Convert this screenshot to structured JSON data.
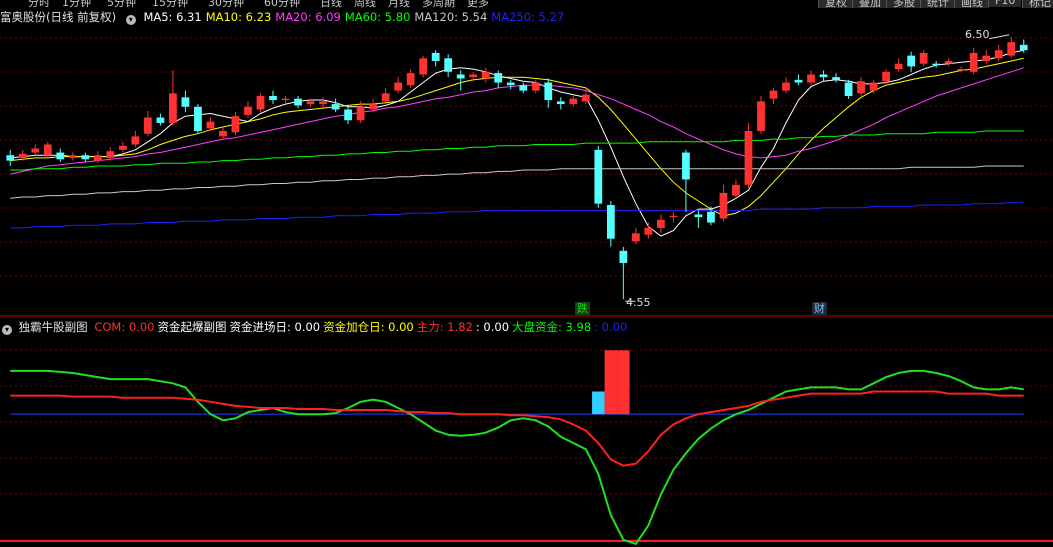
{
  "topbar": {
    "tabs": [
      "分时",
      "1分钟",
      "5分钟",
      "15分钟",
      "30分钟",
      "60分钟",
      "日线",
      "周线",
      "月线",
      "多周期",
      "更多"
    ],
    "buttons": [
      "复权",
      "叠加",
      "多股",
      "统计",
      "画线",
      "F10",
      "标记"
    ]
  },
  "main_panel": {
    "stock_name": "富奥股份(日线 前复权)",
    "ma": [
      {
        "label": "MA5: 6.31",
        "color": "#ffffff"
      },
      {
        "label": "MA10: 6.23",
        "color": "#ffff00"
      },
      {
        "label": "MA20: 6.09",
        "color": "#ff40ff"
      },
      {
        "label": "MA60: 5.80",
        "color": "#00ff00"
      },
      {
        "label": "MA120: 5.54",
        "color": "#c8c8c8"
      },
      {
        "label": "MA250: 5.27",
        "color": "#2020ff"
      }
    ],
    "high_label": "6.50",
    "low_label": "4.55",
    "event_tags": [
      "跌",
      "财"
    ]
  },
  "sub_panel": {
    "title": "独霸牛股副图",
    "indicators": [
      {
        "label": "COM: 0.00",
        "color": "#ff3030"
      },
      {
        "label": "资金起爆副图",
        "color": "#ffffff"
      },
      {
        "label": "资金进场日: 0.00",
        "color": "#ffffff"
      },
      {
        "label": "资金加仓日: 0.00",
        "color": "#ffff00"
      },
      {
        "label": "主力: 1.82",
        "color": "#ff3030"
      },
      {
        "label": ": 0.00",
        "color": "#ffffff"
      },
      {
        "label": "大盘资金: 3.98",
        "color": "#00ff00"
      },
      {
        "label": ": 0.00",
        "color": "#2020ff"
      }
    ]
  },
  "colors": {
    "up": "#ff3232",
    "down": "#54ffff",
    "grid": "#7a0000"
  },
  "chart_data": {
    "type": "candlestick",
    "ohlc": [
      [
        5.62,
        5.58,
        5.66,
        5.54
      ],
      [
        5.6,
        5.63,
        5.66,
        5.58
      ],
      [
        5.64,
        5.67,
        5.7,
        5.62
      ],
      [
        5.62,
        5.7,
        5.72,
        5.6
      ],
      [
        5.64,
        5.59,
        5.67,
        5.57
      ],
      [
        5.6,
        5.62,
        5.64,
        5.58
      ],
      [
        5.62,
        5.59,
        5.64,
        5.57
      ],
      [
        5.58,
        5.62,
        5.65,
        5.56
      ],
      [
        5.6,
        5.65,
        5.68,
        5.58
      ],
      [
        5.66,
        5.69,
        5.72,
        5.64
      ],
      [
        5.7,
        5.76,
        5.8,
        5.68
      ],
      [
        5.78,
        5.9,
        5.95,
        5.76
      ],
      [
        5.9,
        5.86,
        5.93,
        5.84
      ],
      [
        5.86,
        6.08,
        6.25,
        5.84
      ],
      [
        6.05,
        5.98,
        6.1,
        5.94
      ],
      [
        5.98,
        5.8,
        6.0,
        5.78
      ],
      [
        5.82,
        5.87,
        5.9,
        5.8
      ],
      [
        5.76,
        5.8,
        5.83,
        5.74
      ],
      [
        5.79,
        5.91,
        5.94,
        5.77
      ],
      [
        5.92,
        5.98,
        6.02,
        5.9
      ],
      [
        5.96,
        6.06,
        6.08,
        5.94
      ],
      [
        6.06,
        6.03,
        6.1,
        6.0
      ],
      [
        6.03,
        6.04,
        6.06,
        6.01
      ],
      [
        6.04,
        5.99,
        6.06,
        5.97
      ],
      [
        6.0,
        6.02,
        6.04,
        5.98
      ],
      [
        6.0,
        6.02,
        6.05,
        5.97
      ],
      [
        6.0,
        5.96,
        6.04,
        5.94
      ],
      [
        5.96,
        5.88,
        5.99,
        5.85
      ],
      [
        5.88,
        5.98,
        6.02,
        5.86
      ],
      [
        5.96,
        6.0,
        6.04,
        5.94
      ],
      [
        6.02,
        6.08,
        6.12,
        6.0
      ],
      [
        6.1,
        6.16,
        6.2,
        6.08
      ],
      [
        6.14,
        6.23,
        6.26,
        6.12
      ],
      [
        6.22,
        6.34,
        6.36,
        6.2
      ],
      [
        6.38,
        6.32,
        6.4,
        6.28
      ],
      [
        6.34,
        6.24,
        6.37,
        6.2
      ],
      [
        6.22,
        6.19,
        6.25,
        6.1
      ],
      [
        6.2,
        6.22,
        6.24,
        6.17
      ],
      [
        6.19,
        6.24,
        6.27,
        6.16
      ],
      [
        6.23,
        6.16,
        6.25,
        6.12
      ],
      [
        6.16,
        6.14,
        6.18,
        6.11
      ],
      [
        6.14,
        6.1,
        6.16,
        6.08
      ],
      [
        6.1,
        6.16,
        6.18,
        6.08
      ],
      [
        6.16,
        6.03,
        6.19,
        5.97
      ],
      [
        6.02,
        6.0,
        6.05,
        5.96
      ],
      [
        6.0,
        6.04,
        6.06,
        5.98
      ],
      [
        6.02,
        6.07,
        6.12,
        6.0
      ],
      [
        5.66,
        5.26,
        5.69,
        5.23
      ],
      [
        5.25,
        5.0,
        5.28,
        4.94
      ],
      [
        4.91,
        4.82,
        4.94,
        4.55
      ],
      [
        4.98,
        5.04,
        5.08,
        4.96
      ],
      [
        5.03,
        5.08,
        5.12,
        5.0
      ],
      [
        5.08,
        5.14,
        5.18,
        5.04
      ],
      [
        5.16,
        5.17,
        5.2,
        5.12
      ],
      [
        5.64,
        5.44,
        5.66,
        5.2
      ],
      [
        5.18,
        5.16,
        5.21,
        5.08
      ],
      [
        5.2,
        5.12,
        5.24,
        5.1
      ],
      [
        5.15,
        5.34,
        5.4,
        5.13
      ],
      [
        5.32,
        5.4,
        5.44,
        5.3
      ],
      [
        5.4,
        5.8,
        5.86,
        5.38
      ],
      [
        5.8,
        6.02,
        6.06,
        5.78
      ],
      [
        6.04,
        6.1,
        6.12,
        6.0
      ],
      [
        6.1,
        6.16,
        6.2,
        6.08
      ],
      [
        6.18,
        6.16,
        6.22,
        6.14
      ],
      [
        6.16,
        6.22,
        6.25,
        6.14
      ],
      [
        6.22,
        6.2,
        6.25,
        6.17
      ],
      [
        6.2,
        6.18,
        6.23,
        6.16
      ],
      [
        6.16,
        6.06,
        6.18,
        6.04
      ],
      [
        6.08,
        6.17,
        6.2,
        6.06
      ],
      [
        6.1,
        6.16,
        6.18,
        6.08
      ],
      [
        6.17,
        6.24,
        6.26,
        6.14
      ],
      [
        6.26,
        6.3,
        6.34,
        6.24
      ],
      [
        6.36,
        6.28,
        6.39,
        6.24
      ],
      [
        6.3,
        6.38,
        6.4,
        6.28
      ],
      [
        6.3,
        6.29,
        6.32,
        6.27
      ],
      [
        6.3,
        6.32,
        6.34,
        6.28
      ],
      [
        6.25,
        6.26,
        6.28,
        6.24
      ],
      [
        6.24,
        6.38,
        6.42,
        6.22
      ],
      [
        6.32,
        6.36,
        6.4,
        6.3
      ],
      [
        6.34,
        6.4,
        6.44,
        6.32
      ],
      [
        6.36,
        6.46,
        6.5,
        6.34
      ],
      [
        6.44,
        6.4,
        6.48,
        6.38
      ]
    ],
    "ylim": [
      4.5,
      6.58
    ],
    "ma": {
      "MA5": [
        5.6,
        5.61,
        5.62,
        5.62,
        5.62,
        5.61,
        5.61,
        5.61,
        5.61,
        5.63,
        5.66,
        5.72,
        5.78,
        5.86,
        5.91,
        5.92,
        5.93,
        5.91,
        5.89,
        5.87,
        5.93,
        5.97,
        6.0,
        6.02,
        6.03,
        6.03,
        6.01,
        5.98,
        5.98,
        5.97,
        5.99,
        6.02,
        6.09,
        6.16,
        6.23,
        6.26,
        6.27,
        6.26,
        6.24,
        6.21,
        6.19,
        6.17,
        6.16,
        6.12,
        6.09,
        6.07,
        6.05,
        5.88,
        5.68,
        5.46,
        5.26,
        5.09,
        5.02,
        5.06,
        5.17,
        5.22,
        5.22,
        5.25,
        5.3,
        5.36,
        5.53,
        5.67,
        5.86,
        6.03,
        6.13,
        6.17,
        6.18,
        6.17,
        6.15,
        6.15,
        6.16,
        6.18,
        6.22,
        6.26,
        6.29,
        6.3,
        6.31,
        6.32,
        6.33,
        6.35,
        6.38,
        6.4
      ],
      "MA10": [
        5.58,
        5.59,
        5.6,
        5.6,
        5.61,
        5.61,
        5.61,
        5.61,
        5.61,
        5.62,
        5.63,
        5.66,
        5.7,
        5.73,
        5.76,
        5.78,
        5.81,
        5.83,
        5.85,
        5.87,
        5.89,
        5.92,
        5.94,
        5.95,
        5.96,
        5.97,
        5.98,
        5.99,
        6.0,
        6.0,
        6.01,
        6.02,
        6.04,
        6.07,
        6.1,
        6.13,
        6.16,
        6.18,
        6.19,
        6.2,
        6.2,
        6.2,
        6.19,
        6.18,
        6.16,
        6.14,
        6.12,
        6.05,
        5.96,
        5.85,
        5.74,
        5.63,
        5.52,
        5.42,
        5.34,
        5.28,
        5.22,
        5.17,
        5.19,
        5.24,
        5.32,
        5.42,
        5.52,
        5.63,
        5.73,
        5.82,
        5.9,
        5.98,
        6.05,
        6.1,
        6.14,
        6.16,
        6.18,
        6.2,
        6.21,
        6.23,
        6.25,
        6.26,
        6.28,
        6.3,
        6.32,
        6.34
      ],
      "MA20": [
        5.48,
        5.5,
        5.52,
        5.54,
        5.55,
        5.56,
        5.57,
        5.58,
        5.59,
        5.6,
        5.61,
        5.63,
        5.64,
        5.66,
        5.68,
        5.7,
        5.72,
        5.74,
        5.75,
        5.77,
        5.79,
        5.81,
        5.83,
        5.85,
        5.87,
        5.89,
        5.91,
        5.92,
        5.94,
        5.95,
        5.97,
        5.98,
        6.0,
        6.02,
        6.04,
        6.05,
        6.07,
        6.09,
        6.1,
        6.12,
        6.13,
        6.14,
        6.14,
        6.14,
        6.13,
        6.12,
        6.1,
        6.07,
        6.04,
        6.0,
        5.96,
        5.92,
        5.87,
        5.83,
        5.78,
        5.74,
        5.7,
        5.66,
        5.63,
        5.61,
        5.6,
        5.61,
        5.62,
        5.65,
        5.67,
        5.7,
        5.73,
        5.77,
        5.81,
        5.85,
        5.9,
        5.94,
        5.98,
        6.02,
        6.06,
        6.09,
        6.12,
        6.15,
        6.18,
        6.21,
        6.24,
        6.27
      ],
      "MA60": [
        5.51,
        5.51,
        5.52,
        5.52,
        5.52,
        5.53,
        5.53,
        5.54,
        5.54,
        5.54,
        5.55,
        5.55,
        5.56,
        5.56,
        5.56,
        5.57,
        5.57,
        5.58,
        5.58,
        5.59,
        5.59,
        5.6,
        5.6,
        5.61,
        5.61,
        5.62,
        5.62,
        5.63,
        5.63,
        5.64,
        5.64,
        5.65,
        5.65,
        5.66,
        5.66,
        5.67,
        5.67,
        5.68,
        5.68,
        5.69,
        5.69,
        5.69,
        5.7,
        5.7,
        5.7,
        5.7,
        5.71,
        5.71,
        5.71,
        5.71,
        5.71,
        5.72,
        5.72,
        5.72,
        5.72,
        5.72,
        5.72,
        5.72,
        5.73,
        5.73,
        5.73,
        5.74,
        5.74,
        5.75,
        5.75,
        5.76,
        5.76,
        5.77,
        5.77,
        5.77,
        5.78,
        5.78,
        5.78,
        5.78,
        5.79,
        5.79,
        5.79,
        5.79,
        5.8,
        5.8,
        5.8,
        5.8
      ],
      "MA120": [
        5.3,
        5.31,
        5.31,
        5.32,
        5.32,
        5.33,
        5.33,
        5.34,
        5.34,
        5.35,
        5.35,
        5.36,
        5.36,
        5.37,
        5.37,
        5.38,
        5.38,
        5.39,
        5.39,
        5.4,
        5.4,
        5.41,
        5.41,
        5.42,
        5.42,
        5.43,
        5.43,
        5.44,
        5.44,
        5.45,
        5.45,
        5.46,
        5.46,
        5.47,
        5.47,
        5.48,
        5.48,
        5.49,
        5.49,
        5.5,
        5.5,
        5.51,
        5.51,
        5.51,
        5.52,
        5.52,
        5.52,
        5.52,
        5.52,
        5.52,
        5.52,
        5.52,
        5.52,
        5.52,
        5.52,
        5.52,
        5.52,
        5.52,
        5.52,
        5.52,
        5.52,
        5.52,
        5.52,
        5.52,
        5.52,
        5.52,
        5.52,
        5.52,
        5.52,
        5.52,
        5.52,
        5.52,
        5.53,
        5.53,
        5.53,
        5.53,
        5.53,
        5.53,
        5.54,
        5.54,
        5.54,
        5.54
      ],
      "MA250": [
        5.08,
        5.08,
        5.09,
        5.09,
        5.09,
        5.1,
        5.1,
        5.1,
        5.11,
        5.11,
        5.11,
        5.12,
        5.12,
        5.12,
        5.13,
        5.13,
        5.13,
        5.14,
        5.14,
        5.14,
        5.15,
        5.15,
        5.15,
        5.16,
        5.16,
        5.16,
        5.17,
        5.17,
        5.17,
        5.18,
        5.18,
        5.18,
        5.19,
        5.19,
        5.19,
        5.2,
        5.2,
        5.2,
        5.21,
        5.21,
        5.21,
        5.21,
        5.21,
        5.21,
        5.21,
        5.21,
        5.21,
        5.21,
        5.21,
        5.21,
        5.21,
        5.21,
        5.21,
        5.21,
        5.21,
        5.21,
        5.21,
        5.21,
        5.21,
        5.21,
        5.22,
        5.22,
        5.22,
        5.22,
        5.22,
        5.23,
        5.23,
        5.23,
        5.23,
        5.24,
        5.24,
        5.24,
        5.24,
        5.25,
        5.25,
        5.25,
        5.25,
        5.26,
        5.26,
        5.26,
        5.27,
        5.27
      ]
    },
    "sub": {
      "ylim": [
        -0.6,
        1.4
      ],
      "green": [
        1.1,
        1.1,
        1.1,
        1.1,
        1.09,
        1.08,
        1.06,
        1.04,
        1.02,
        1.02,
        1.02,
        1.02,
        1.0,
        0.98,
        0.94,
        0.8,
        0.68,
        0.62,
        0.64,
        0.7,
        0.72,
        0.74,
        0.7,
        0.68,
        0.68,
        0.68,
        0.69,
        0.74,
        0.8,
        0.82,
        0.8,
        0.74,
        0.68,
        0.6,
        0.52,
        0.48,
        0.47,
        0.48,
        0.5,
        0.55,
        0.62,
        0.64,
        0.62,
        0.56,
        0.46,
        0.4,
        0.34,
        0.1,
        -0.3,
        -0.54,
        -0.58,
        -0.4,
        -0.1,
        0.14,
        0.3,
        0.44,
        0.54,
        0.62,
        0.68,
        0.72,
        0.78,
        0.84,
        0.9,
        0.92,
        0.94,
        0.94,
        0.94,
        0.92,
        0.92,
        0.98,
        1.04,
        1.08,
        1.1,
        1.1,
        1.08,
        1.05,
        1.0,
        0.94,
        0.92,
        0.92,
        0.94,
        0.92
      ],
      "red": [
        0.86,
        0.86,
        0.86,
        0.86,
        0.86,
        0.85,
        0.85,
        0.85,
        0.85,
        0.84,
        0.84,
        0.84,
        0.84,
        0.84,
        0.83,
        0.82,
        0.8,
        0.78,
        0.76,
        0.75,
        0.74,
        0.74,
        0.74,
        0.73,
        0.73,
        0.73,
        0.72,
        0.72,
        0.72,
        0.72,
        0.72,
        0.71,
        0.7,
        0.7,
        0.69,
        0.69,
        0.68,
        0.68,
        0.68,
        0.68,
        0.67,
        0.67,
        0.66,
        0.65,
        0.63,
        0.58,
        0.52,
        0.4,
        0.24,
        0.18,
        0.2,
        0.32,
        0.48,
        0.58,
        0.64,
        0.68,
        0.7,
        0.72,
        0.74,
        0.76,
        0.8,
        0.82,
        0.84,
        0.86,
        0.88,
        0.88,
        0.88,
        0.88,
        0.88,
        0.9,
        0.9,
        0.9,
        0.9,
        0.9,
        0.9,
        0.88,
        0.88,
        0.88,
        0.88,
        0.86,
        0.86,
        0.86
      ],
      "blue_level": 0.68,
      "bars": [
        {
          "index": 47,
          "value": 0.9,
          "color": "#33ccff"
        },
        {
          "index": 48,
          "value": 1.3,
          "color": "#ff3030"
        },
        {
          "index": 49,
          "value": 1.3,
          "color": "#ff3030"
        }
      ]
    }
  }
}
